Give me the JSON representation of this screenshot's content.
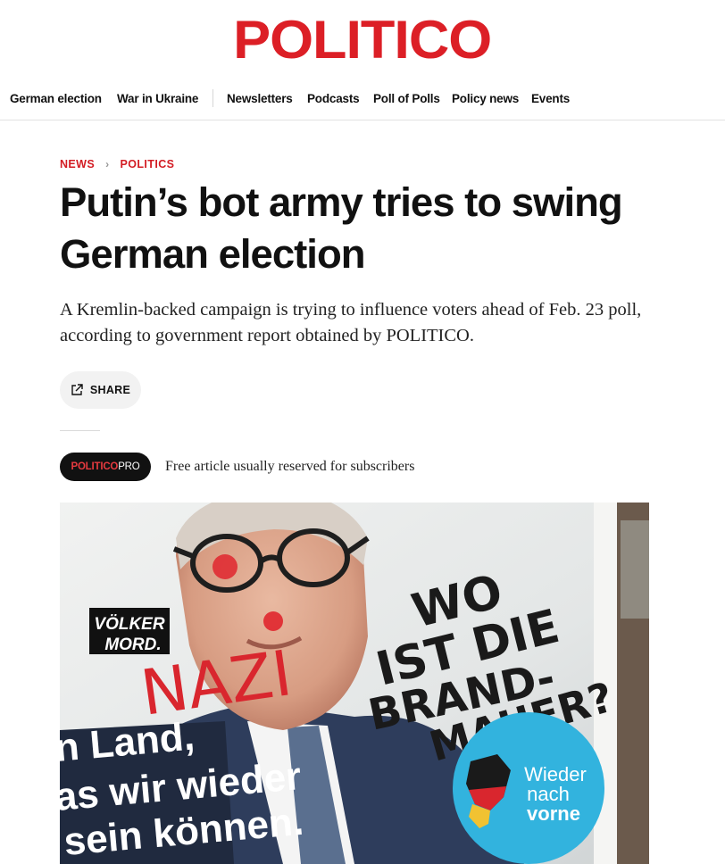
{
  "header": {
    "logo_text": "POLITICO"
  },
  "nav": {
    "items": [
      "German election",
      "War in Ukraine",
      "Newsletters",
      "Podcasts",
      "Poll of Polls",
      "Policy news",
      "Events"
    ]
  },
  "breadcrumb": {
    "section": "NEWS",
    "subsection": "POLITICS"
  },
  "article": {
    "headline_line1": "Putin’s bot army tries to swing",
    "headline_line2": "German election",
    "dek_line1": "A Kremlin-backed campaign is trying to influence voters ahead of Feb. 23 poll,",
    "dek_line2": "according to government report obtained by POLITICO.",
    "share_label": "SHARE"
  },
  "pro_badge": {
    "part1": "POLITICO",
    "part2": "PRO"
  },
  "free_notice": "Free article usually reserved for subscribers",
  "photo": {
    "poster_sticker_line1": "VÖLKER",
    "poster_sticker_line2": "MORD.",
    "graffiti_red": "NAZI",
    "graffiti_black_1": "WO",
    "graffiti_black_2": "IST DIE",
    "graffiti_black_3": "BRAND-",
    "graffiti_black_4": "MAUER?",
    "slogan_line1": "n Land,",
    "slogan_line2": "as wir wieder",
    "slogan_line3": "sein können.",
    "circle_line1": "Wieder",
    "circle_line2": "nach",
    "circle_line3": "vorne"
  },
  "colors": {
    "brand_red": "#dc1f26",
    "breadcrumb_red": "#d31d24",
    "pro_badge_bg": "#111111"
  }
}
